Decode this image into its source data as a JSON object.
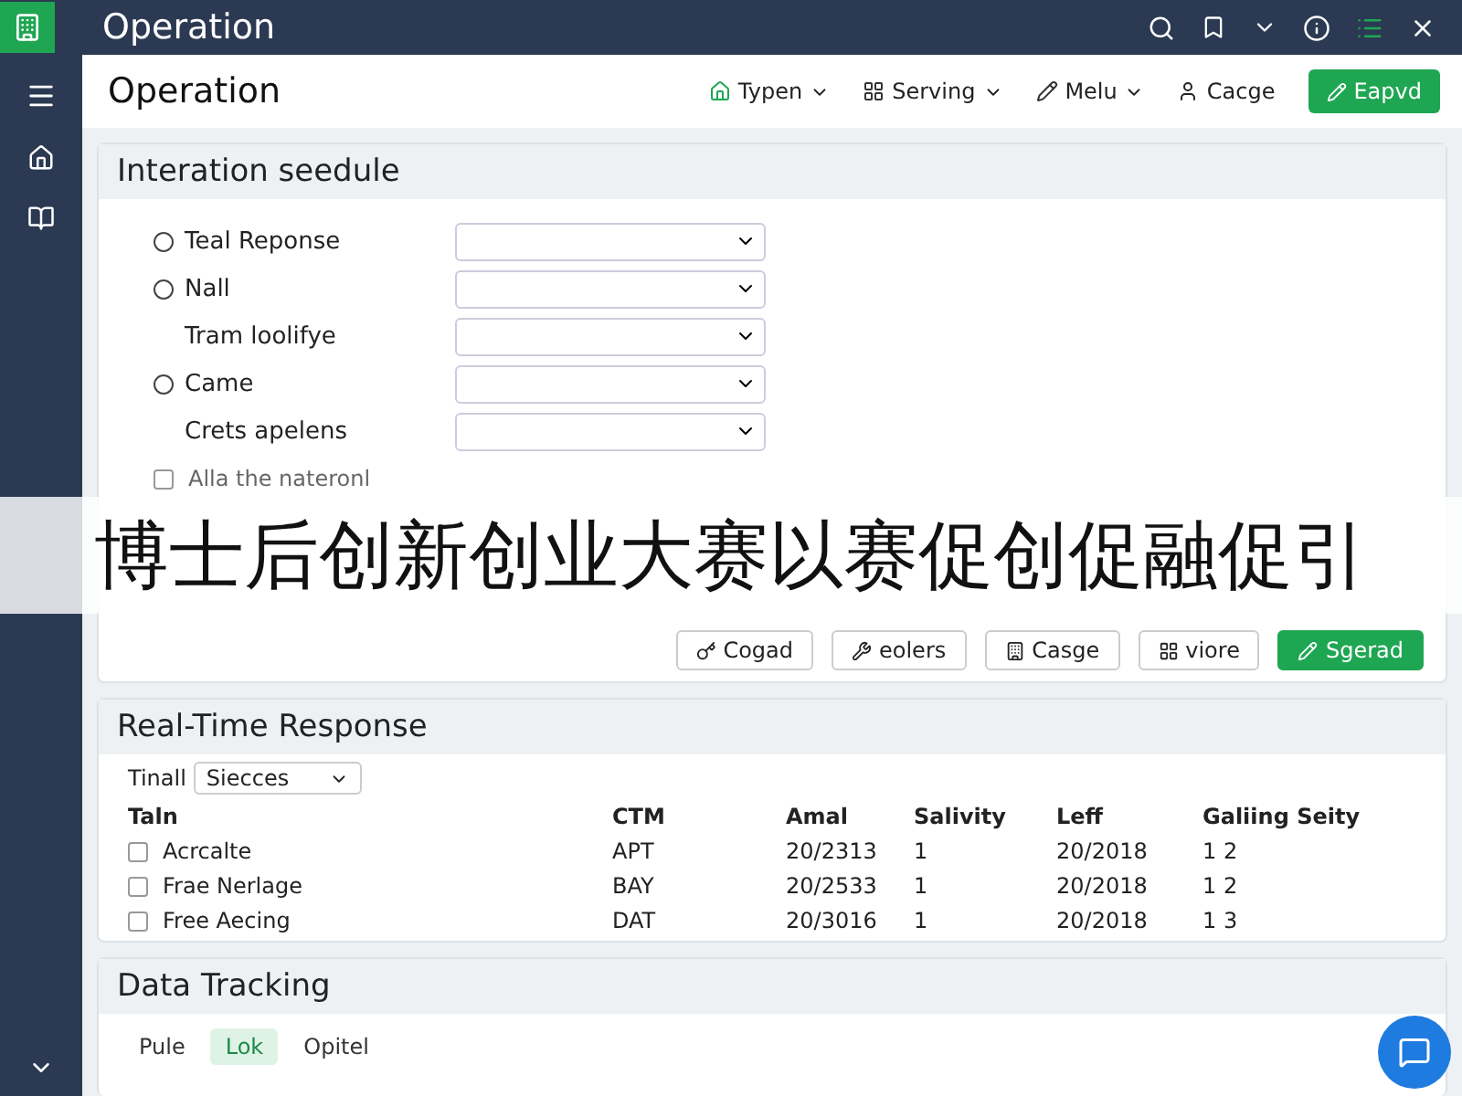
{
  "titlebar": {
    "title": "Operation"
  },
  "header": {
    "title": "Operation",
    "menus": [
      {
        "label": "Typen"
      },
      {
        "label": "Serving"
      },
      {
        "label": "Melu"
      }
    ],
    "link": "Cacge",
    "action": "Eapvd"
  },
  "schedule": {
    "title": "Interation seedule",
    "rows": [
      {
        "kind": "radio",
        "label": "Teal Reponse",
        "selected": false
      },
      {
        "kind": "radio",
        "label": "Nall",
        "selected": false
      },
      {
        "kind": "plain",
        "label": "Tram loolifye"
      },
      {
        "kind": "radio",
        "label": "Came",
        "selected": false
      },
      {
        "kind": "plain",
        "label": "Crets apelens"
      }
    ],
    "checks": [
      {
        "label": "Alla the nateronl",
        "checked": false
      }
    ],
    "buttons": [
      {
        "label": "Cogad",
        "primary": false
      },
      {
        "label": "eolers",
        "primary": false
      },
      {
        "label": "Casge",
        "primary": false
      },
      {
        "label": "viore",
        "primary": false
      },
      {
        "label": "Sgerad",
        "primary": true
      }
    ]
  },
  "response": {
    "title": "Real-Time Response",
    "filter_label": "Tinall",
    "filter_value": "Siecces",
    "columns": [
      "Taln",
      "CTM",
      "Amal",
      "Salivity",
      "Leff",
      "Galiing Seity"
    ],
    "rows": [
      {
        "checked": false,
        "cells": [
          "Acrcalte",
          "APT",
          "20/2313",
          "1",
          "20/2018",
          "1 2"
        ]
      },
      {
        "checked": false,
        "cells": [
          "Frae Nerlage",
          "BAY",
          "20/2533",
          "1",
          "20/2018",
          "1 2"
        ]
      },
      {
        "checked": false,
        "cells": [
          "Free Aecing",
          "DAT",
          "20/3016",
          "1",
          "20/2018",
          "1 3"
        ]
      }
    ]
  },
  "tracking": {
    "title": "Data Tracking",
    "tabs": [
      {
        "label": "Pule",
        "selected": false
      },
      {
        "label": "Lok",
        "selected": true
      },
      {
        "label": "Opitel",
        "selected": false
      }
    ]
  },
  "banner": {
    "text": "博士后创新创业大赛以赛促创促融促引"
  }
}
